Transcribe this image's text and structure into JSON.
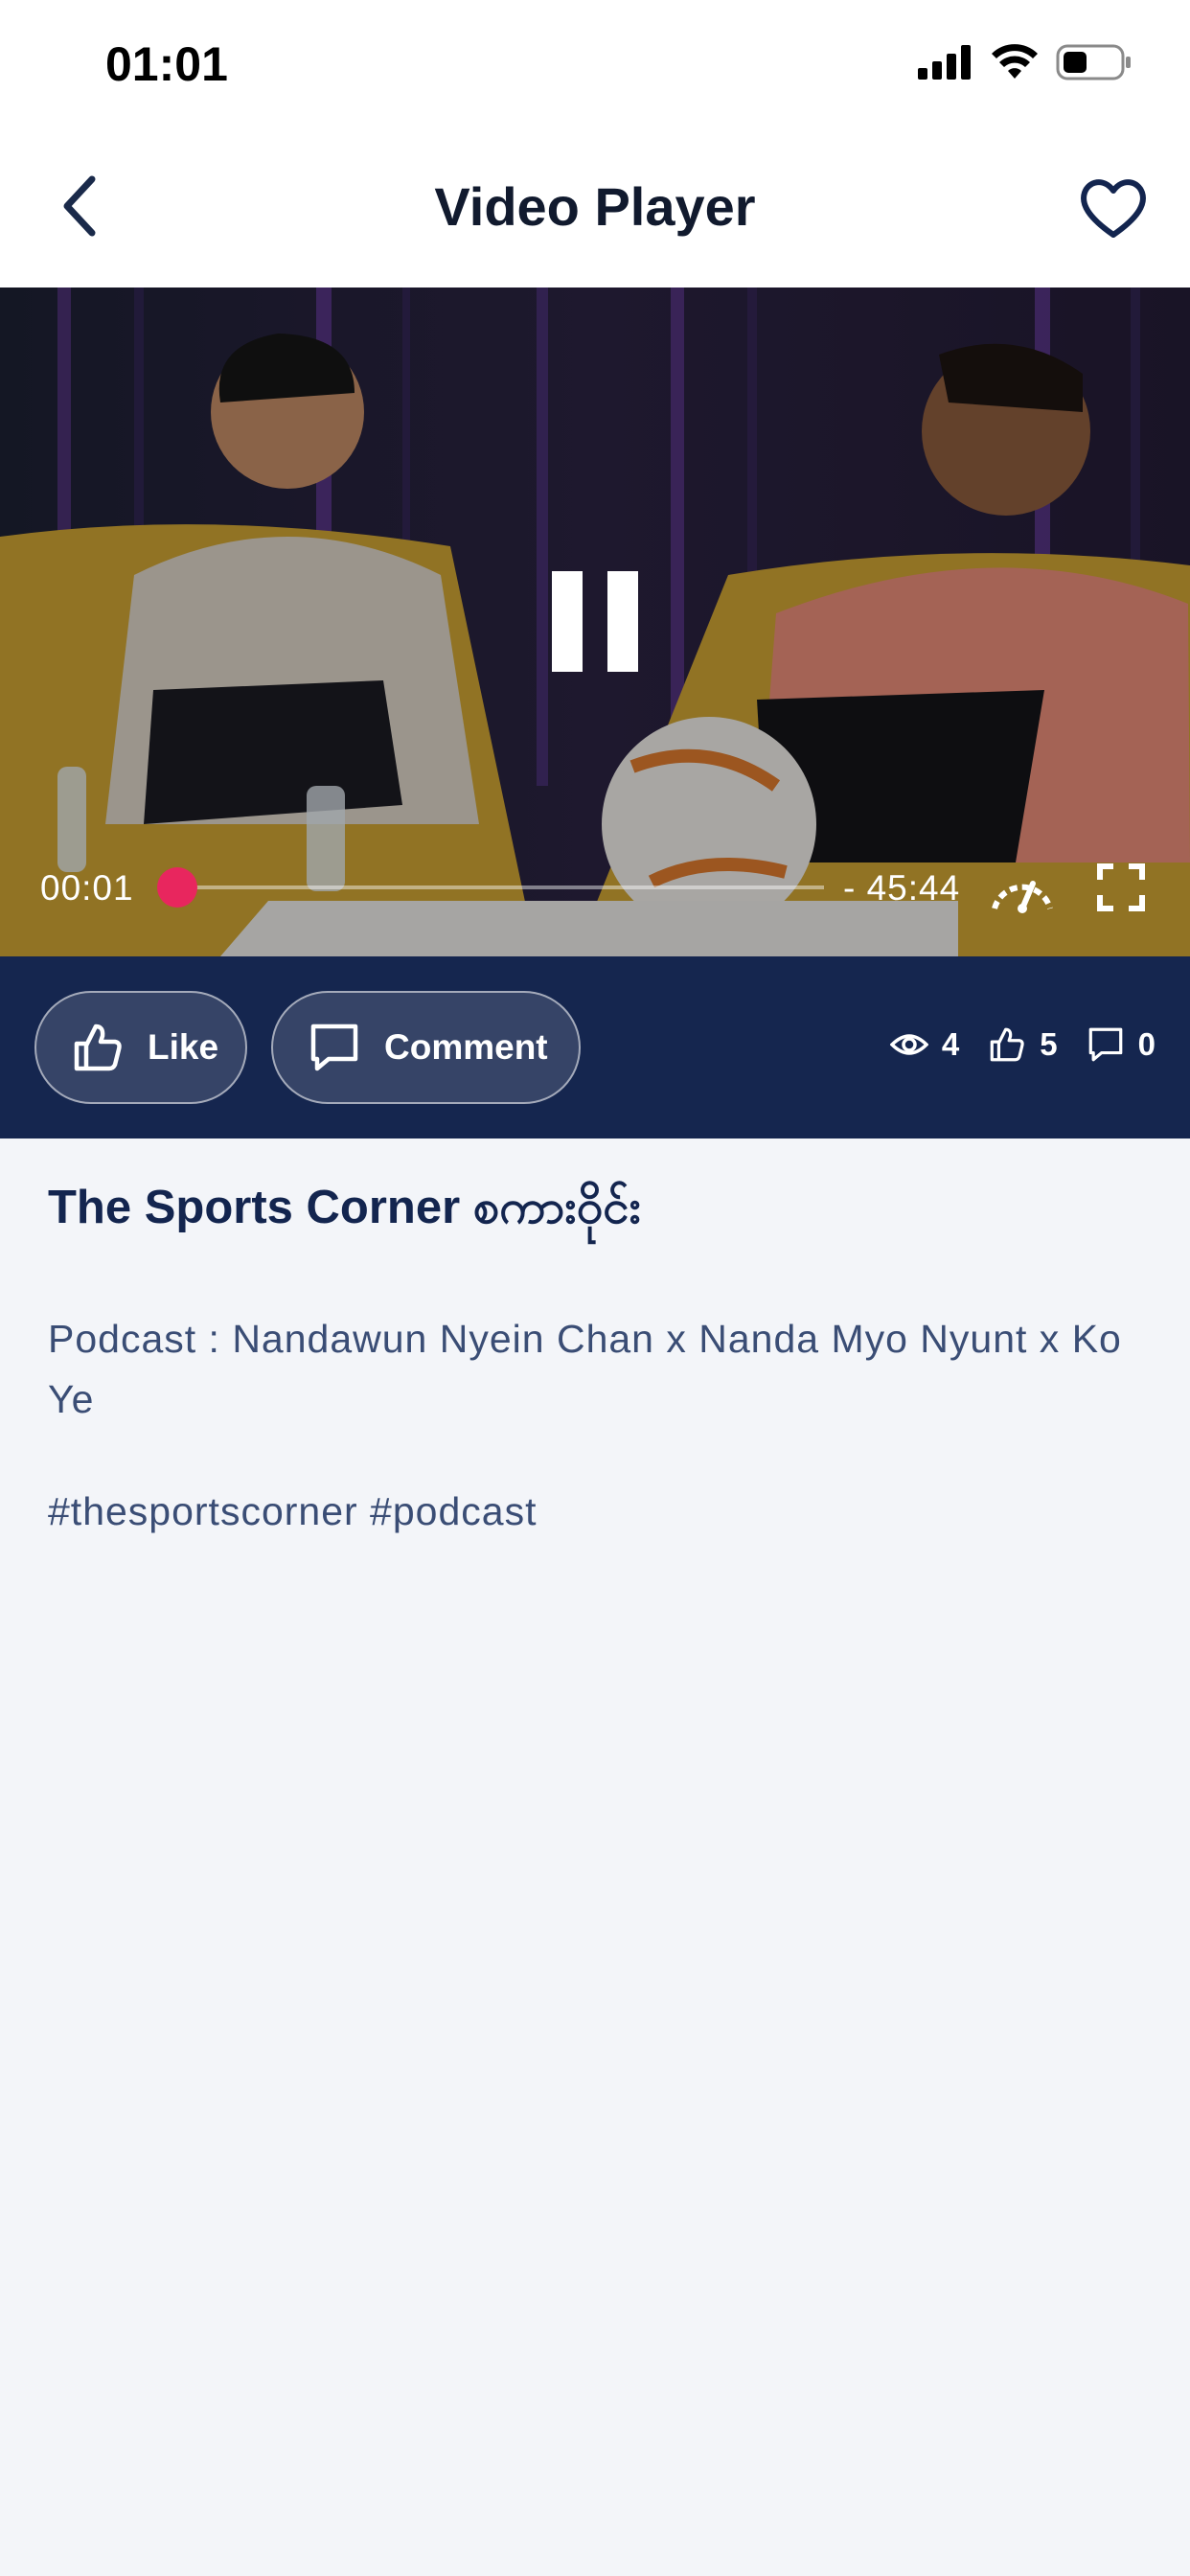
{
  "status_bar": {
    "time": "01:01"
  },
  "header": {
    "title": "Video Player"
  },
  "player": {
    "current_time": "00:01",
    "remaining_time": "- 45:44",
    "progress": 0.0004
  },
  "actions": {
    "like_label": "Like",
    "comment_label": "Comment"
  },
  "stats": {
    "views": "4",
    "likes": "5",
    "comments": "0"
  },
  "video": {
    "title": "The Sports Corner စကားဝိုင်း",
    "description": "Podcast : Nandawun Nyein Chan x Nanda Myo Nyunt x Ko Ye",
    "hashtags": "#thesportscorner #podcast"
  },
  "colors": {
    "accent": "#e8265e",
    "bar_bg": "#15264f"
  },
  "icons": [
    "back-chevron-icon",
    "heart-icon",
    "pause-icon",
    "speedometer-icon",
    "fullscreen-icon",
    "thumbs-up-icon",
    "comment-icon",
    "eye-icon"
  ]
}
